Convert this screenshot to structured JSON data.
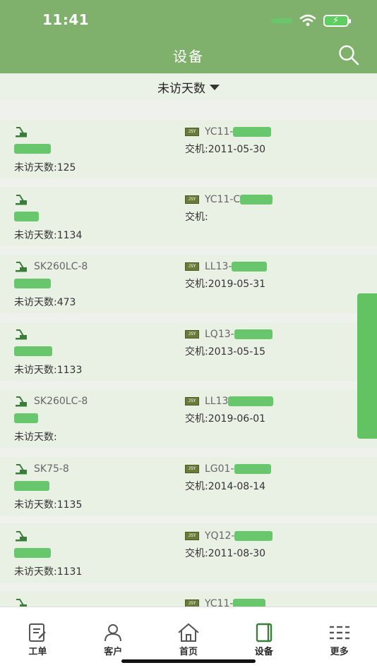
{
  "status_bar": {
    "time": "11:41"
  },
  "header": {
    "title": "设备"
  },
  "filter": {
    "label": "未访天数"
  },
  "items": [
    {
      "model": "",
      "code_prefix": "YC11-",
      "delivery": "交机:2011-05-30",
      "days": "未访天数:125"
    },
    {
      "model": "",
      "code_prefix": "YC11-C",
      "delivery": "交机:",
      "days": "未访天数:1134"
    },
    {
      "model": "SK260LC-8",
      "code_prefix": "LL13-",
      "delivery": "交机:2019-05-31",
      "days": "未访天数:473"
    },
    {
      "model": "",
      "code_prefix": "LQ13-",
      "delivery": "交机:2013-05-15",
      "days": "未访天数:1133"
    },
    {
      "model": "SK260LC-8",
      "code_prefix": "LL13",
      "delivery": "交机:2019-06-01",
      "days": "未访天数:"
    },
    {
      "model": "SK75-8",
      "code_prefix": "LG01-",
      "delivery": "交机:2014-08-14",
      "days": "未访天数:1135"
    },
    {
      "model": "",
      "code_prefix": "YQ12-",
      "delivery": "交机:2011-08-30",
      "days": "未访天数:1131"
    },
    {
      "model": "",
      "code_prefix": "YC11-",
      "delivery": "",
      "days": ""
    }
  ],
  "tabbar": {
    "tabs": [
      {
        "label": "工单",
        "icon": "work-order-icon"
      },
      {
        "label": "客户",
        "icon": "user-icon"
      },
      {
        "label": "首页",
        "icon": "home-icon"
      },
      {
        "label": "设备",
        "icon": "device-icon"
      },
      {
        "label": "更多",
        "icon": "more-icon"
      }
    ],
    "active": "设备"
  },
  "colors": {
    "header": "#7fb06c",
    "accent": "#68c66c",
    "card": "#e9f1e5"
  }
}
